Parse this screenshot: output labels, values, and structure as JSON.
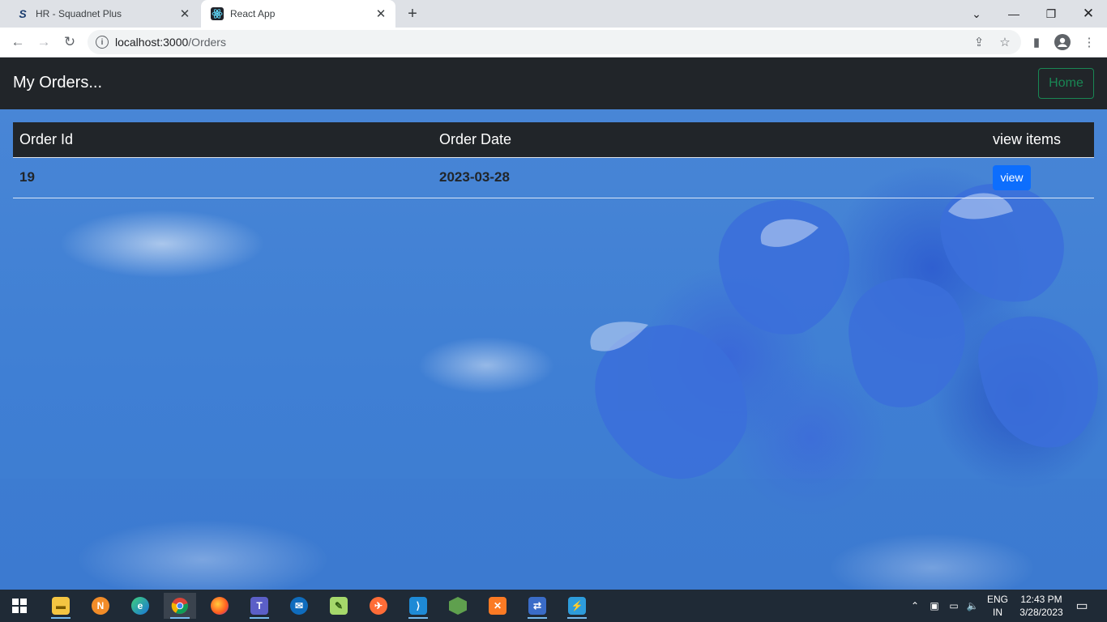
{
  "browser": {
    "tabs": [
      {
        "title": "HR - Squadnet Plus",
        "favicon": "squadnet-s-icon"
      },
      {
        "title": "React App",
        "favicon": "react-logo-icon"
      }
    ],
    "url_host": "localhost:3000",
    "url_path": "/Orders"
  },
  "app": {
    "brand": "My Orders...",
    "home_button": "Home",
    "colors": {
      "navbar": "#212529",
      "home_outline": "#198754",
      "view_button": "#0d6efd"
    }
  },
  "orders": {
    "columns": [
      "Order Id",
      "Order Date",
      "view items"
    ],
    "rows": [
      {
        "id": "19",
        "date": "2023-03-28",
        "action": "view"
      }
    ]
  },
  "taskbar": {
    "apps": [
      "start-icon",
      "file-explorer-icon",
      "network-app-icon",
      "edge-icon",
      "chrome-icon",
      "firefox-icon",
      "teams-icon",
      "outlook-icon",
      "notepad-plus-icon",
      "postman-icon",
      "vscode-icon",
      "nodejs-icon",
      "xampp-icon",
      "network-tool-icon",
      "thunder-app-icon"
    ],
    "language_top": "ENG",
    "language_bottom": "IN",
    "time": "12:43 PM",
    "date": "3/28/2023"
  }
}
